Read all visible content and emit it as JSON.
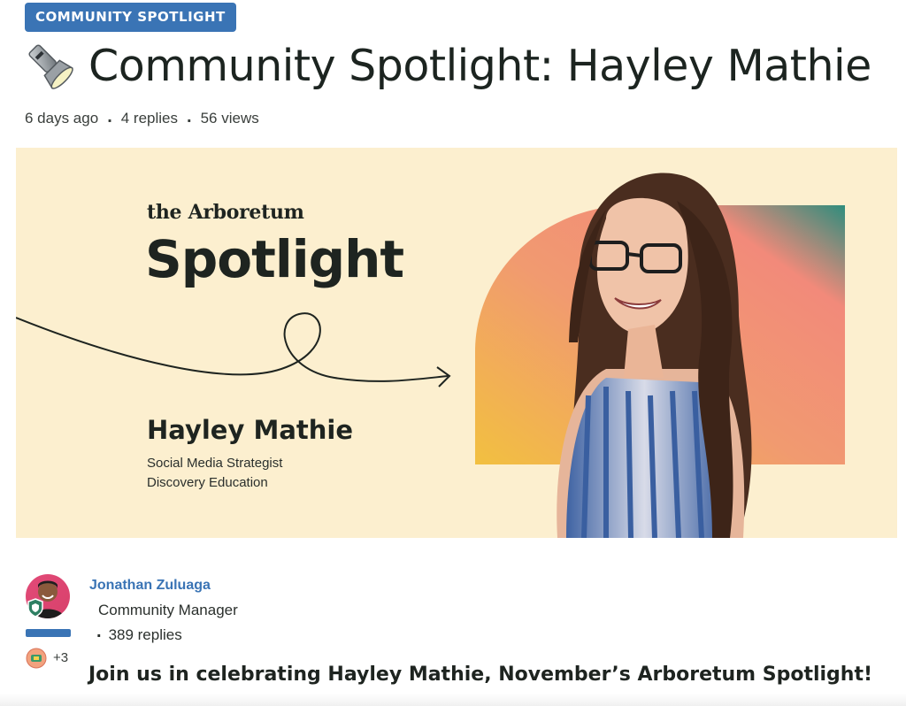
{
  "category_badge": "COMMUNITY SPOTLIGHT",
  "post": {
    "title_icon": "flashlight-icon",
    "title": "Community Spotlight: Hayley Mathie",
    "meta": {
      "age": "6 days ago",
      "replies": "4 replies",
      "views": "56 views"
    }
  },
  "banner": {
    "brand": "the Arboretum",
    "heading": "Spotlight",
    "name": "Hayley Mathie",
    "role_line1": "Social Media Strategist",
    "role_line2": "Discovery Education"
  },
  "author": {
    "name": "Jonathan Zuluaga",
    "role": "Community Manager",
    "replies": "389 replies",
    "extra_badges": "+3"
  },
  "body": {
    "lead": "Join us in celebrating Hayley Mathie, November’s Arboretum Spotlight!"
  },
  "colors": {
    "accent": "#3a74b5",
    "banner_bg": "#fcefcf"
  }
}
